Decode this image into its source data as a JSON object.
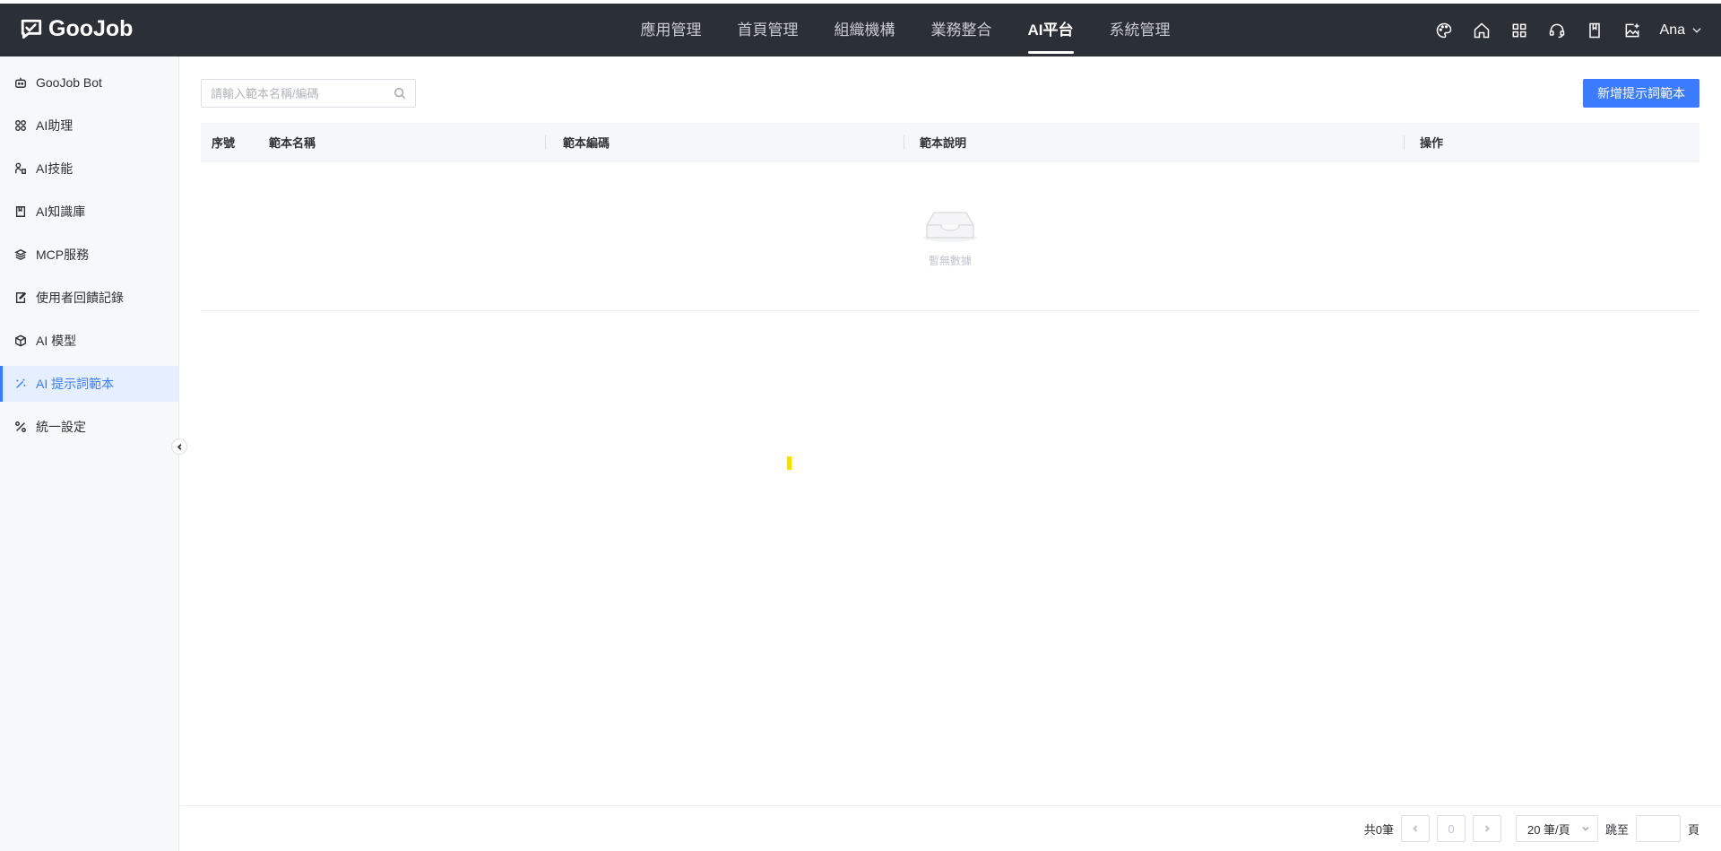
{
  "header": {
    "logo_text": "GooJob",
    "nav": [
      {
        "label": "應用管理",
        "active": false
      },
      {
        "label": "首頁管理",
        "active": false
      },
      {
        "label": "組織機構",
        "active": false
      },
      {
        "label": "業務整合",
        "active": false
      },
      {
        "label": "AI平台",
        "active": true
      },
      {
        "label": "系統管理",
        "active": false
      }
    ],
    "icons": [
      "palette-icon",
      "home-icon",
      "apps-grid-icon",
      "support-icon",
      "book-icon",
      "image-add-icon"
    ],
    "user_name": "Ana"
  },
  "sidebar": {
    "items": [
      {
        "label": "GooJob Bot",
        "icon": "robot-icon"
      },
      {
        "label": "AI助理",
        "icon": "grid-icon"
      },
      {
        "label": "AI技能",
        "icon": "skill-icon"
      },
      {
        "label": "AI知識庫",
        "icon": "book-icon"
      },
      {
        "label": "MCP服務",
        "icon": "layers-icon"
      },
      {
        "label": "使用者回饋記錄",
        "icon": "edit-note-icon"
      },
      {
        "label": "AI 模型",
        "icon": "cube-icon"
      },
      {
        "label": "AI 提示詞範本",
        "icon": "magic-wand-icon",
        "active": true
      },
      {
        "label": "統一設定",
        "icon": "tools-icon"
      }
    ]
  },
  "main": {
    "search_placeholder": "請輸入範本名稱/編碼",
    "add_button": "新增提示詞範本",
    "table": {
      "columns": [
        "序號",
        "範本名稱",
        "範本編碼",
        "範本說明",
        "操作"
      ],
      "rows": [],
      "empty_text": "暫無數據"
    },
    "pagination": {
      "total_text": "共0筆",
      "current_page": "0",
      "page_size": "20 筆/頁",
      "jump_label": "跳至",
      "page_suffix": "頁"
    }
  },
  "colors": {
    "primary": "#3b7cff",
    "topbar": "#2b2f36",
    "sidebar_bg": "#f7f8fa"
  }
}
